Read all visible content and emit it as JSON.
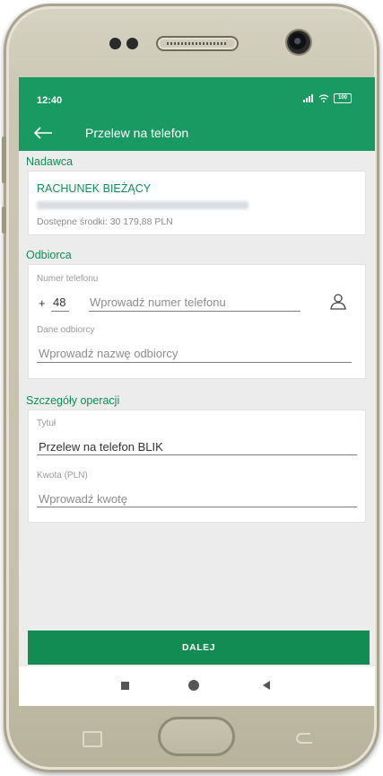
{
  "status": {
    "time": "12:40",
    "battery": "100"
  },
  "appbar": {
    "title": "Przelew na telefon",
    "back_icon": "arrow-left-icon"
  },
  "sender": {
    "header": "Nadawca",
    "account_name": "RACHUNEK BIEŻĄCY",
    "available": "Dostępne środki: 30 179,88 PLN"
  },
  "recipient": {
    "header": "Odbiorca",
    "phone_label": "Numer telefonu",
    "prefix_plus": "+",
    "prefix_code": "48",
    "phone_placeholder": "Wprowadź numer telefonu",
    "contact_icon": "person-icon",
    "name_label": "Dane odbiorcy",
    "name_placeholder": "Wprowadź nazwę odbiorcy"
  },
  "details": {
    "header": "Szczegóły operacji",
    "title_label": "Tytuł",
    "title_value": "Przelew na telefon BLIK",
    "amount_label": "Kwota (PLN)",
    "amount_placeholder": "Wprowadź kwotę"
  },
  "actions": {
    "next_label": "DALEJ"
  },
  "colors": {
    "brand": "#1a9a63",
    "accent_text": "#0e8d57",
    "button": "#138c54"
  }
}
